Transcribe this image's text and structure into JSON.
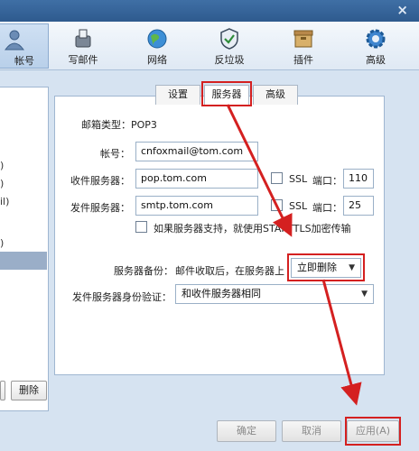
{
  "window": {
    "close_glyph": "×"
  },
  "toolbar": {
    "items": [
      {
        "label": "帐号",
        "icon": "account-icon"
      },
      {
        "label": "写邮件",
        "icon": "compose-icon"
      },
      {
        "label": "网络",
        "icon": "network-globe-icon"
      },
      {
        "label": "反垃圾",
        "icon": "antispam-shield-icon"
      },
      {
        "label": "插件",
        "icon": "plugin-box-icon"
      },
      {
        "label": "高级",
        "icon": "gear-icon"
      }
    ],
    "active_index": 0
  },
  "left_panel": {
    "fragments": [
      ")",
      ")",
      "il)",
      ")"
    ],
    "button_partial": "",
    "delete_label": "删除"
  },
  "tabs": [
    {
      "label": "设置"
    },
    {
      "label": "服务器"
    },
    {
      "label": "高级"
    }
  ],
  "active_tab": "服务器",
  "form": {
    "mailbox_type_label": "邮箱类型：POP3",
    "account_label": "帐号：",
    "account_value": "cnfoxmail@tom.com",
    "incoming_label": "收件服务器：",
    "incoming_value": "pop.tom.com",
    "incoming_ssl_label": "SSL",
    "incoming_port_label": "端口：",
    "incoming_port_value": "110",
    "outgoing_label": "发件服务器：",
    "outgoing_value": "smtp.tom.com",
    "outgoing_ssl_label": "SSL",
    "outgoing_port_label": "端口：",
    "outgoing_port_value": "25",
    "starttls_label": "如果服务器支持，就使用STARTTLS加密传输",
    "backup_label": "服务器备份：",
    "backup_text": "邮件收取后，在服务器上",
    "backup_select": "立即删除",
    "auth_label": "发件服务器身份验证：",
    "auth_select": "和收件服务器相同"
  },
  "buttons": {
    "ok": "确定",
    "cancel": "取消",
    "apply": "应用(A)"
  },
  "colors": {
    "highlight_red": "#d42020",
    "title_blue": "#2e5a8e"
  }
}
